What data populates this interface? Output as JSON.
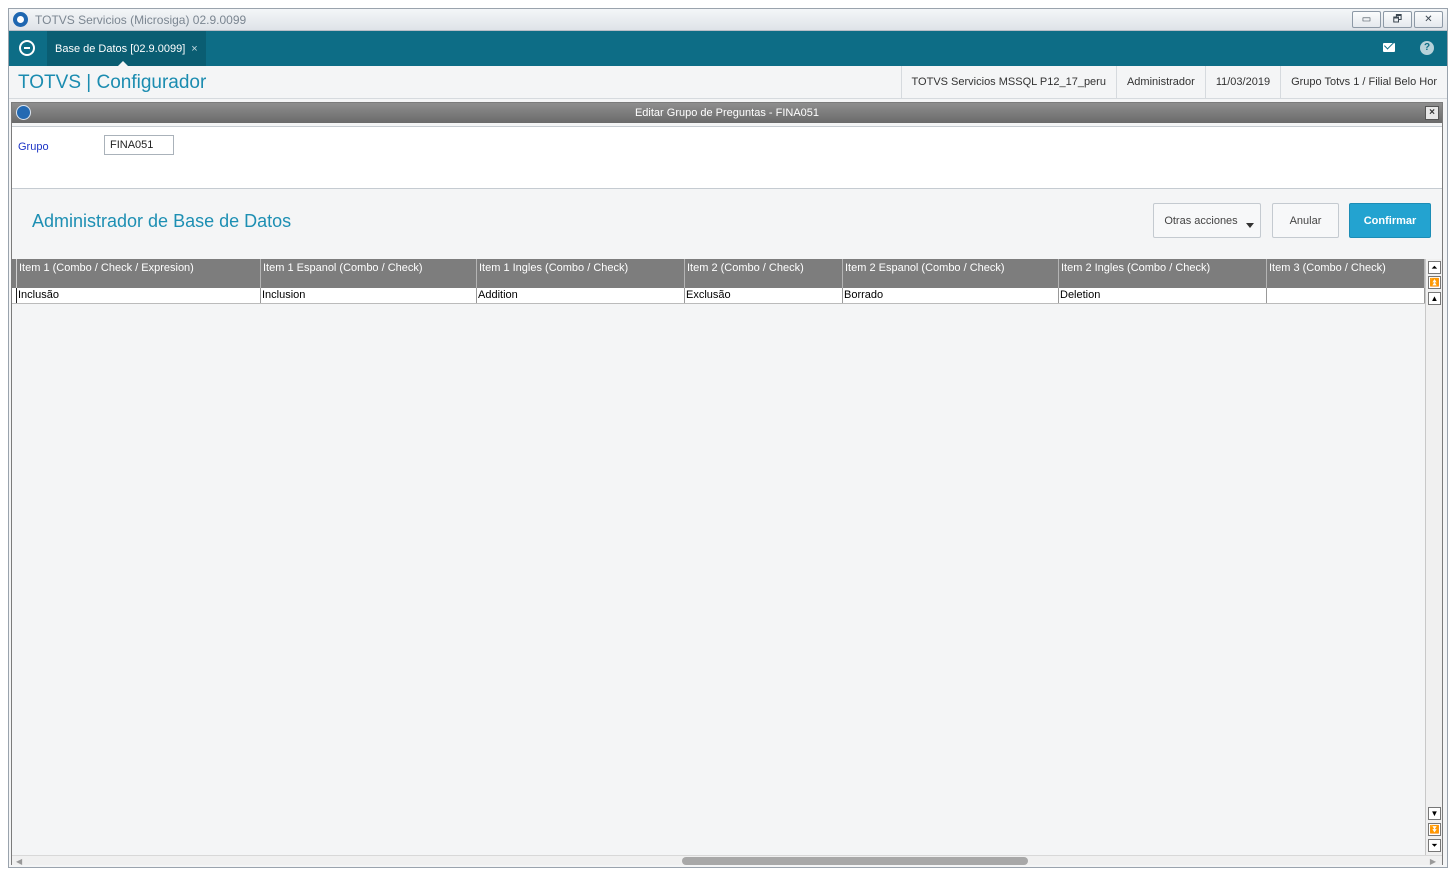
{
  "window": {
    "title": "TOTVS Servicios (Microsiga) 02.9.0099",
    "controls": {
      "minimize": "▭",
      "restore": "🗗",
      "close": "✕"
    }
  },
  "tabbar": {
    "tab_label": "Base de Datos [02.9.0099]",
    "tab_close": "×",
    "help_symbol": "?"
  },
  "header": {
    "brand": "TOTVS | Configurador",
    "environment": "TOTVS Servicios MSSQL P12_17_peru",
    "user": "Administrador",
    "date": "11/03/2019",
    "branch": "Grupo Totvs 1 / Filial Belo Hor"
  },
  "dialog": {
    "title": "Editar Grupo de Preguntas - FINA051",
    "close": "×",
    "form": {
      "group_label": "Grupo",
      "group_value": "FINA051"
    },
    "section_title": "Administrador de Base de Datos",
    "buttons": {
      "more": "Otras acciones",
      "cancel": "Anular",
      "confirm": "Confirmar"
    }
  },
  "grid": {
    "columns": [
      "Item 1 (Combo / Check / Expresion)",
      "Item 1 Espanol (Combo / Check)",
      "Item 1 Ingles (Combo / Check)",
      "Item 2 (Combo / Check)",
      "Item 2 Espanol (Combo / Check)",
      "Item 2 Ingles (Combo / Check)",
      "Item 3 (Combo / Check)"
    ],
    "rows": [
      [
        "Inclusão",
        "Inclusion",
        "Addition",
        "Exclusão",
        "Borrado",
        "Deletion",
        ""
      ]
    ]
  }
}
